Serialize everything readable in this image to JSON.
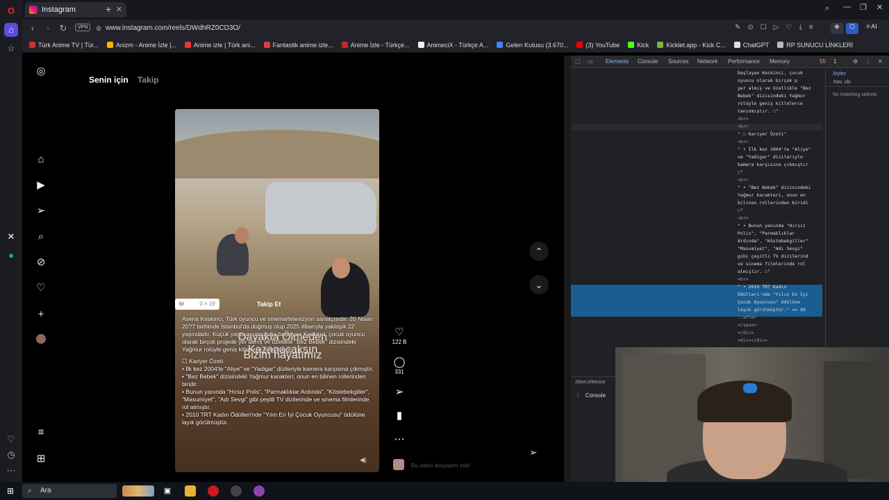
{
  "browser": {
    "tab_title": "Instagram",
    "url": "www.instagram.com/reels/DWdhRZ0CD3O/",
    "vpn_label": "VPN",
    "bookmarks": [
      "Türk Anime TV | Tür...",
      "Anizm - Anime İzle |...",
      "Anime izle | Türk ani...",
      "Fantastik anime izle...",
      "Anime İzle - Türkçe...",
      "AnimeciX - Türkçe A...",
      "Gelen Kutusu (3.670...",
      "(3) YouTube",
      "Kick",
      "Kicklet.app - Kick C...",
      "ChatGPT",
      "RP SUNUCU LİNKLERİ"
    ]
  },
  "instagram": {
    "tabs": [
      "Senin için",
      "Takip"
    ],
    "reel": {
      "follow": "Takip Et",
      "tooltip_tag": "br",
      "tooltip_size": "0 × 19",
      "overlay_line1": "Dayakta Ölmeden Kazanacaksın",
      "overlay_line2": "Bizim hayatımız",
      "caption": [
        "Asena Keskinci, Türk oyuncu ve sinema/televizyon sanatçısıdır. 20 Nisan 20?? tarihinde İstanbul'da doğmuş olup 2025 itibarıyla yaklaşık 22 yaşındadır. Küçük yaşta oyunculuğa başlayan Keskinci, çocuk oyuncu olarak birçok projede yer almış ve özellikle \"Bez Bebek\" dizisindeki Yağmur rolüyle geniş kitlelerce tanınmıştır.",
        "",
        "☐ Kariyer Özeti",
        "• İlk kez 2004'te \"Aliye\" ve \"Yadigar\" dizileriyle kamera karşısına çıkmıştır.",
        "• \"Bez Bebek\" dizisindeki Yağmur karakteri, onun en bilinen rollerinden biridir.",
        "• Bunun yanında \"Hırsız Polis\", \"Parmaklıklar Ardında\", \"Köstebekgiller\", \"Masumiyet\", \"Adı Sevgi\" gibi çeşitli TV dizilerinde ve sinema filmlerinde rol almıştır.",
        "• 2010 TRT Kadın Ödülleri'nde \"Yılın En İyi Çocuk Oyuncusu\" ödülüne layık görülmüştür."
      ],
      "likes": "122 B",
      "comments": "331",
      "bottom_hint": "Bu video dosyasını indir"
    }
  },
  "devtools": {
    "tabs": [
      "Elements",
      "Console",
      "Sources",
      "Network",
      "Performance",
      "Memory"
    ],
    "error_count": "55",
    "warn_count": "1",
    "styles_tab": "Styles",
    "filter_placeholder": ":hov .cls",
    "no_matching": "No matching selecto",
    "dom_lines": [
      "başlayan Keskinci, çocuk",
      "oyuncu olarak birçok p",
      "yer almış ve özellikle \"Bez",
      "Bebek\" dizisindeki Yağmur",
      "rolüyle geniş kitlelerce",
      "tanınmıştır. ☐\"",
      "<br>",
      "<br>",
      "\" ☐ Kariyer Özeti\"",
      "<br>",
      "\" • İlk kez 2004'te \"Aliye\"",
      "ve \"Yadigar\" dizileriyle",
      "kamera karşısına çıkmıştır",
      "☐\"",
      "<br>",
      "\" • \"Bez Bebek\" dizisindeki",
      "Yağmur karakteri, onun en",
      "bilinen rollerinden biridi",
      "☐\"",
      "<br>",
      "\" • Bunun yanında \"Hırsız",
      "Polis\", \"Parmaklıklar",
      "Ardında\", \"Köstebekgiller\"",
      "\"Masumiyet\", \"Adı Sevgi\"",
      "gibi çeşitli TV dizilerind",
      "ve sinema filmlerinde rol",
      "almıştır. ☐\"",
      "<br>",
      "\" • 2010 TRT Kadın",
      "Ödülleri'nde \"Yılın En İyi",
      "Çocuk Oyuncusu\" ödülüne",
      "layık görülmüştür.\" == $0",
      "::after",
      "</span>",
      "</div>",
      "<div></div>"
    ],
    "drawer_crumb": "28wv.xhkezso",
    "drawer_tab": "Console"
  },
  "taskbar": {
    "search_placeholder": "Ara"
  }
}
